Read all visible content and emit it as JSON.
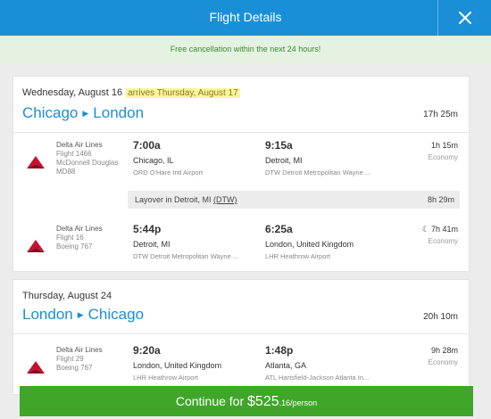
{
  "header": {
    "title": "Flight Details"
  },
  "banner": {
    "text": "Free cancellation within the next 24 hours!"
  },
  "trip1": {
    "date": "Wednesday, August 16",
    "arrives_note": "arrives Thursday, August 17",
    "origin": "Chicago",
    "destination": "London",
    "total_duration": "17h 25m",
    "segments": [
      {
        "airline": "Delta Air Lines",
        "flight": "Flight 1466",
        "aircraft": "McDonnell Douglas MD88",
        "dep_time": "7:00a",
        "dep_city": "Chicago, IL",
        "dep_airport": "ORD O'Hare Intl Airport",
        "arr_time": "9:15a",
        "arr_city": "Detroit, MI",
        "arr_airport": "DTW Detroit Metropolitan Wayne ...",
        "duration": "1h 15m",
        "cabin": "Economy"
      },
      {
        "airline": "Delta Air Lines",
        "flight": "Flight 16",
        "aircraft": "Boeing 767",
        "dep_time": "5:44p",
        "dep_city": "Detroit, MI",
        "dep_airport": "DTW Detroit Metropolitan Wayne ...",
        "arr_time": "6:25a",
        "arr_city": "London, United Kingdom",
        "arr_airport": "LHR Heathrow Airport",
        "duration": "7h 41m",
        "cabin": "Economy"
      }
    ],
    "layover": {
      "text": "Layover in Detroit, MI",
      "code": "(DTW)",
      "duration": "8h 29m"
    }
  },
  "trip2": {
    "date": "Thursday, August 24",
    "origin": "London",
    "destination": "Chicago",
    "total_duration": "20h 10m",
    "segments": [
      {
        "airline": "Delta Air Lines",
        "flight": "Flight 29",
        "aircraft": "Boeing 767",
        "dep_time": "9:20a",
        "dep_city": "London, United Kingdom",
        "dep_airport": "LHR Heathrow Airport",
        "arr_time": "1:48p",
        "arr_city": "Atlanta, GA",
        "arr_airport": "ATL Hartsfield-Jackson Atlanta In...",
        "duration": "9h 28m",
        "cabin": "Economy"
      }
    ]
  },
  "continue_button": {
    "label": "Continue for",
    "price_main": "$525",
    "price_cents": ".16",
    "per": "/person"
  },
  "icons": {
    "close": "close-icon",
    "moon": "overnight-moon-icon",
    "route_arrow": "route-arrow-icon",
    "airline_logo": "delta-logo-icon"
  },
  "colors": {
    "header": "#1a8fd8",
    "banner_bg": "#e4f3e1",
    "banner_text": "#3c8a2e",
    "route": "#1a8fd8",
    "button": "#3fa62a",
    "highlight": "#fbf59a"
  }
}
